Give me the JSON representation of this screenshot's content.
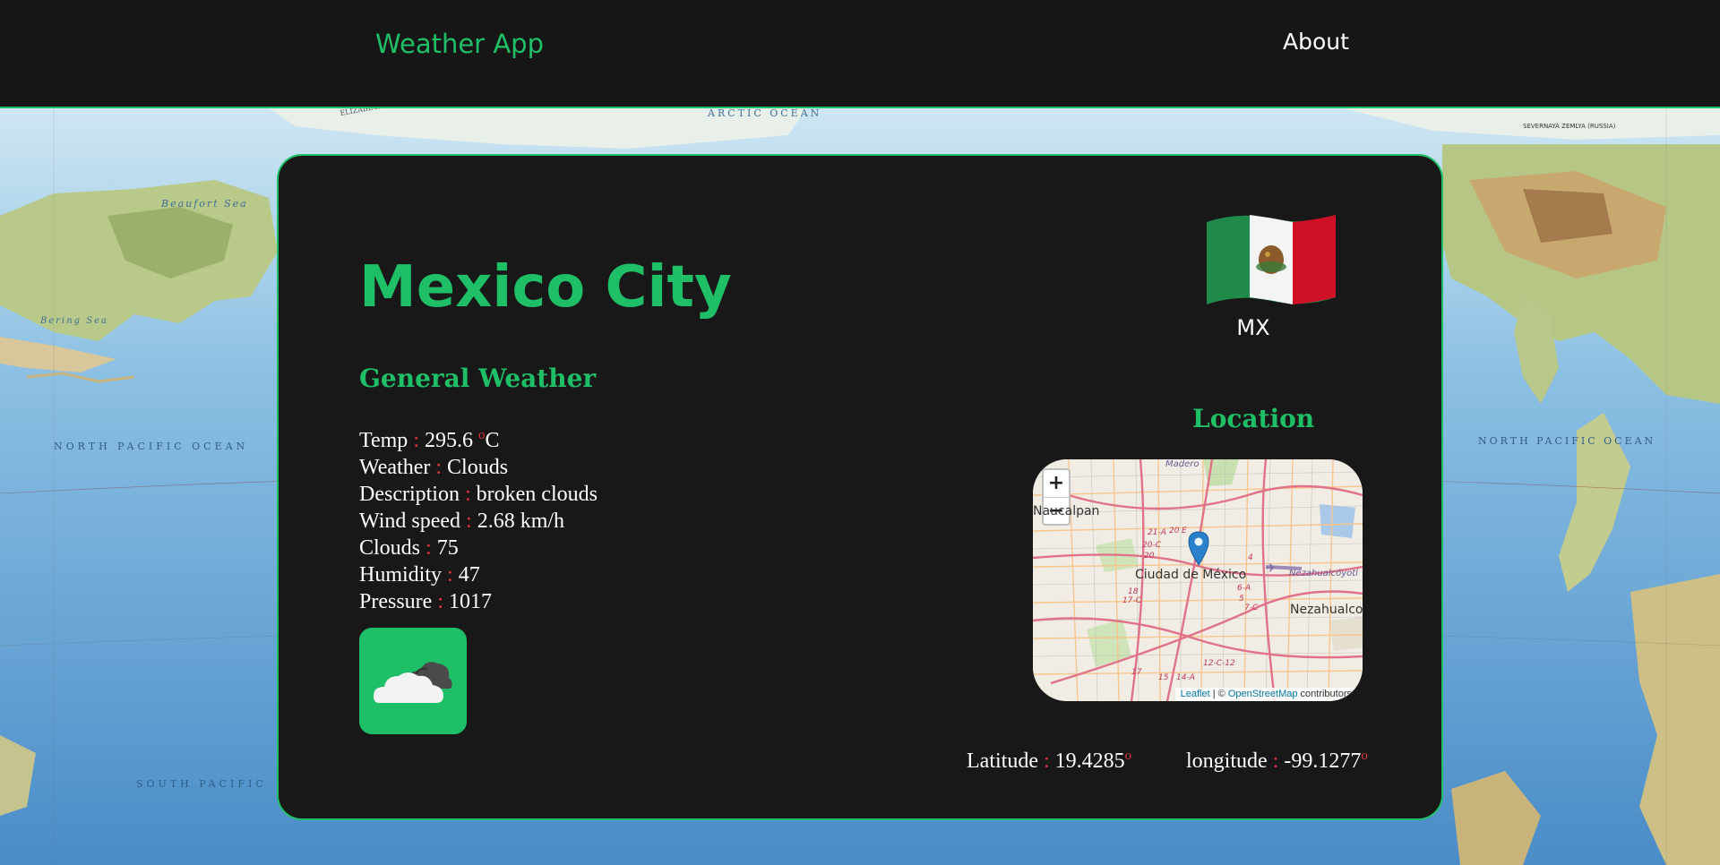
{
  "nav": {
    "brand": "Weather App",
    "about": "About"
  },
  "background": {
    "labels": {
      "arctic": "ARCTIC OCEAN",
      "elizabeth": "ELIZABETH ISLA",
      "beaufort": "Beaufort Sea",
      "bering": "Bering Sea",
      "npo": "NORTH PACIFIC OCEAN",
      "spacific": "SOUTH PACIFIC",
      "npo_right": "NORTH PACIFIC OCEAN",
      "severnaya": "SEVERNAYA ZEMLYA (RUSSIA)"
    }
  },
  "city": "Mexico City",
  "general": {
    "title": "General Weather",
    "rows": [
      {
        "label": "Temp",
        "value": "295.6",
        "unit": "C"
      },
      {
        "label": "Weather",
        "value": "Clouds"
      },
      {
        "label": "Description",
        "value": "broken clouds"
      },
      {
        "label": "Wind speed",
        "value": "2.68 km/h"
      },
      {
        "label": "Clouds",
        "value": "75"
      },
      {
        "label": "Humidity",
        "value": "47"
      },
      {
        "label": "Pressure",
        "value": "1017"
      }
    ],
    "separator": ":",
    "degree": "o",
    "icon": "broken-clouds-icon"
  },
  "country": {
    "code": "MX",
    "flag_icon": "mexico-flag-icon"
  },
  "location": {
    "title": "Location",
    "map": {
      "zoom_in": "+",
      "zoom_out": "−",
      "labels": {
        "center": "Ciudad de México",
        "left": "Naucalpan",
        "right": "Nezahualco",
        "neza_small": "Nezahualcóyotl",
        "madero": "Madero"
      },
      "attribution": {
        "leaflet": "Leaflet",
        "sep": " | © ",
        "osm": "OpenStreetMap",
        "tail": " contributors"
      }
    },
    "latitude_label": "Latitude",
    "latitude": "19.4285",
    "longitude_label": "longitude",
    "longitude": "-99.1277"
  },
  "colors": {
    "accent": "#1fbf68",
    "separator": "#e03140",
    "card": "#181818",
    "nav": "#161616"
  }
}
